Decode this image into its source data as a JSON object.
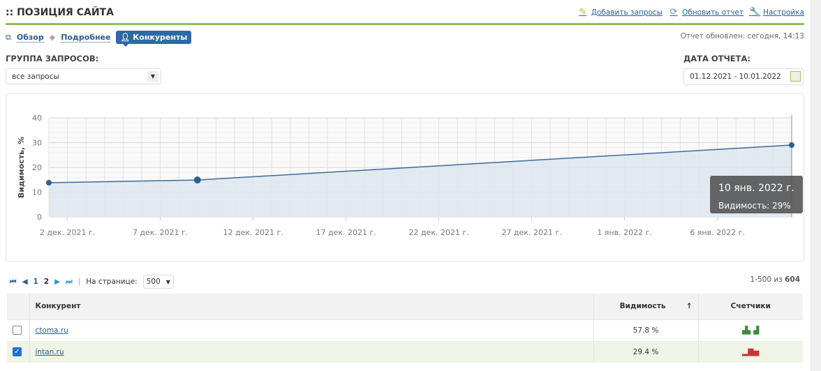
{
  "header": {
    "title": ":: ПОЗИЦИЯ САЙТА",
    "actions": [
      {
        "label": "Добавить запросы",
        "icon": "pencil-icon"
      },
      {
        "label": "Обновить отчет",
        "icon": "refresh-icon"
      },
      {
        "label": "Настройка",
        "icon": "wrench-icon"
      }
    ]
  },
  "tabs": [
    {
      "label": "Обзор",
      "icon": "copy-icon"
    },
    {
      "label": "Подробнее",
      "icon": "diamond-icon"
    },
    {
      "label": "Конкуренты",
      "icon": "user-icon",
      "active": true
    }
  ],
  "updated": "Отчет обновлен: сегодня, 14:13",
  "filters": {
    "group_label": "ГРУППА ЗАПРОСОВ:",
    "group_value": "все запросы",
    "date_label": "ДАТА ОТЧЕТА:",
    "date_value": "01.12.2021 - 10.01.2022"
  },
  "chart_data": {
    "type": "area",
    "ylabel": "Видимость, %",
    "ylim": [
      0,
      40
    ],
    "yticks": [
      0,
      10,
      20,
      30,
      40
    ],
    "xdomain_days": [
      0,
      40
    ],
    "xticks": [
      {
        "day": 1,
        "label": "2 дек. 2021 г."
      },
      {
        "day": 6,
        "label": "7 дек. 2021 г."
      },
      {
        "day": 11,
        "label": "12 дек. 2021 г."
      },
      {
        "day": 16,
        "label": "17 дек. 2021 г."
      },
      {
        "day": 21,
        "label": "22 дек. 2021 г."
      },
      {
        "day": 26,
        "label": "27 дек. 2021 г."
      },
      {
        "day": 31,
        "label": "1 янв. 2022 г."
      },
      {
        "day": 36,
        "label": "6 янв. 2022 г."
      }
    ],
    "points": [
      {
        "day": 0,
        "date": "1 дек. 2021 г.",
        "value": 13.8
      },
      {
        "day": 8,
        "date": "9 дек. 2021 г.",
        "value": 14.9
      },
      {
        "day": 40,
        "date": "10 янв. 2022 г.",
        "value": 29
      }
    ],
    "tooltip": {
      "title": "10 янв. 2022 г.",
      "text": "Видимость: 29%"
    },
    "color": "#3d6a9a",
    "fill": "#dde6ef"
  },
  "pager": {
    "pages": [
      "1",
      "2"
    ],
    "per_page_label": "На странице:",
    "per_page": "500",
    "range": "1-500 из ",
    "total": "604"
  },
  "table": {
    "headers": [
      "Конкурент",
      "Видимость",
      "Счетчики"
    ],
    "sort_icon": "↑",
    "rows": [
      {
        "domain": "ctoma.ru",
        "visibility": "57.8 %",
        "checked": false
      },
      {
        "domain": "intan.ru",
        "visibility": "29.4 %",
        "checked": true
      }
    ]
  }
}
